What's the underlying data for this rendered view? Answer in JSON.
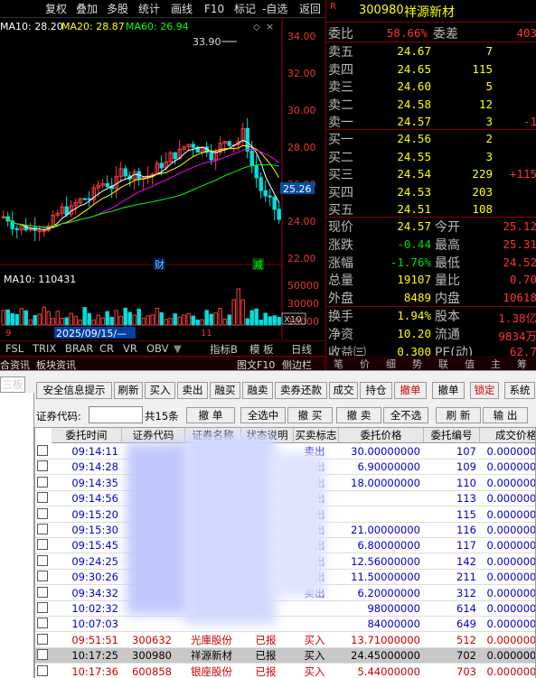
{
  "toolbar": {
    "tabs": [
      "复权",
      "叠加",
      "多股",
      "统计",
      "画线",
      "F10",
      "标记",
      "-自选",
      "返回"
    ]
  },
  "indicators": {
    "ma10": "MA10: 28.20",
    "ma20": "MA20: 28.87",
    "ma60": "MA60: 26.94",
    "high_mark": "33.90",
    "price_tag": "25.26",
    "date_tag": "2025/09/15/—",
    "cai": "财",
    "jian": "减",
    "vol_ma10": "MA10: 110431",
    "vol_x10": "X10",
    "day9": "9",
    "day11": "11",
    "vol_50000": "50000",
    "vol_30000": "30000",
    "vol_10000": "10000"
  },
  "price_axis": [
    "34.00",
    "32.00",
    "30.00",
    "28.00",
    "26.00",
    "24.00",
    "22.00"
  ],
  "bottom_tabs": {
    "tabs": [
      "FSL",
      "TRIX",
      "BRAR",
      "CR",
      "VR",
      "OBV"
    ],
    "indicator_btn": "指标B",
    "template_btn": "模 板",
    "daily": "日线"
  },
  "panel_links": {
    "left": [
      "合资讯",
      "板块资讯"
    ],
    "right": [
      "图文F10",
      "侧边栏"
    ],
    "icons": [
      "笔",
      "价",
      "细",
      "势",
      "联",
      "值",
      "主",
      "筹"
    ]
  },
  "quote": {
    "r_mark": "R",
    "code": "300980",
    "name": "祥源新材",
    "ratio_lbl": "委比",
    "ratio": "58.66%",
    "diff_lbl": "委差",
    "diff": "403",
    "asks": [
      {
        "label": "卖五",
        "price": "24.67",
        "vol": "7",
        "chg": ""
      },
      {
        "label": "卖四",
        "price": "24.65",
        "vol": "115",
        "chg": ""
      },
      {
        "label": "卖三",
        "price": "24.60",
        "vol": "5",
        "chg": ""
      },
      {
        "label": "卖二",
        "price": "24.58",
        "vol": "12",
        "chg": ""
      },
      {
        "label": "卖一",
        "price": "24.57",
        "vol": "3",
        "chg": "-1"
      }
    ],
    "bids": [
      {
        "label": "买一",
        "price": "24.56",
        "vol": "2",
        "chg": ""
      },
      {
        "label": "买二",
        "price": "24.55",
        "vol": "3",
        "chg": ""
      },
      {
        "label": "买三",
        "price": "24.54",
        "vol": "229",
        "chg": "+115"
      },
      {
        "label": "买四",
        "price": "24.53",
        "vol": "203",
        "chg": ""
      },
      {
        "label": "买五",
        "price": "24.51",
        "vol": "108",
        "chg": ""
      }
    ],
    "stats": [
      {
        "l1": "现价",
        "v1": "24.57",
        "l2": "今开",
        "v2": "25.12"
      },
      {
        "l1": "涨跌",
        "v1": "-0.44",
        "l2": "最高",
        "v2": "25.31"
      },
      {
        "l1": "涨幅",
        "v1": "-1.76%",
        "l2": "最低",
        "v2": "24.52"
      },
      {
        "l1": "总量",
        "v1": "19107",
        "l2": "量比",
        "v2": "0.70"
      },
      {
        "l1": "外盘",
        "v1": "8489",
        "l2": "内盘",
        "v2": "10618"
      }
    ],
    "stats2": [
      {
        "l1": "换手",
        "v1": "1.94%",
        "l2": "股本",
        "v2": "1.38亿"
      },
      {
        "l1": "净资",
        "v1": "10.20",
        "l2": "流通",
        "v2": "9834万"
      },
      {
        "l1": "收益㈢",
        "v1": "0.300",
        "l2": "PE(动)",
        "v2": "62.7"
      }
    ]
  },
  "trade": {
    "left_tab": "三板",
    "buttons": [
      "安全信息提示",
      "刷新",
      "买入",
      "卖出",
      "融买",
      "融卖",
      "卖券还款",
      "成交",
      "持仓",
      "撤单",
      "撤单",
      "锁定",
      "系统"
    ],
    "code_label": "证券代码:",
    "code_value": "",
    "count_label": "共15条",
    "row2_buttons": [
      "撤 单",
      "全选中",
      "撤 买",
      "撤 卖",
      "全不选",
      "刷 新",
      "输 出"
    ],
    "columns": [
      "委托时间",
      "证券代码",
      "证券名称",
      "状态说明",
      "买卖标志",
      "委托价格",
      "委托编号",
      "成交价格"
    ],
    "rows": [
      {
        "time": "09:14:11",
        "code": "",
        "name": "",
        "status": "",
        "side": "卖出",
        "price": "30.00000000",
        "id": "107",
        "deal": "0.00000000"
      },
      {
        "time": "09:14:28",
        "code": "",
        "name": "",
        "status": "",
        "side": "卖出",
        "price": "6.90000000",
        "id": "109",
        "deal": "0.00000000"
      },
      {
        "time": "09:14:35",
        "code": "",
        "name": "",
        "status": "",
        "side": "卖出",
        "price": "18.00000000",
        "id": "110",
        "deal": "0.00000000"
      },
      {
        "time": "09:14:56",
        "code": "",
        "name": "",
        "status": "",
        "side": "卖出",
        "price": "",
        "id": "113",
        "deal": "0.00000000"
      },
      {
        "time": "09:15:20",
        "code": "",
        "name": "",
        "status": "",
        "side": "卖出",
        "price": "",
        "id": "115",
        "deal": "0.00000000"
      },
      {
        "time": "09:15:30",
        "code": "",
        "name": "",
        "status": "",
        "side": "卖出",
        "price": "21.00000000",
        "id": "116",
        "deal": "0.00000000"
      },
      {
        "time": "09:15:45",
        "code": "",
        "name": "",
        "status": "",
        "side": "卖出",
        "price": "6.80000000",
        "id": "117",
        "deal": "0.00000000"
      },
      {
        "time": "09:24:25",
        "code": "",
        "name": "",
        "status": "",
        "side": "卖出",
        "price": "12.56000000",
        "id": "142",
        "deal": "0.00000000"
      },
      {
        "time": "09:30:26",
        "code": "",
        "name": "",
        "status": "",
        "side": "卖出",
        "price": "11.50000000",
        "id": "211",
        "deal": "0.00000000"
      },
      {
        "time": "09:34:32",
        "code": "",
        "name": "",
        "status": "",
        "side": "卖出",
        "price": "6.20000000",
        "id": "312",
        "deal": "0.00000000"
      },
      {
        "time": "10:02:32",
        "code": "",
        "name": "",
        "status": "",
        "side": "",
        "price": "98000000",
        "id": "614",
        "deal": "0.00000000"
      },
      {
        "time": "10:07:03",
        "code": "",
        "name": "",
        "status": "",
        "side": "",
        "price": "84000000",
        "id": "649",
        "deal": "0.00000000"
      },
      {
        "time": "09:51:51",
        "code": "300632",
        "name": "光庫股份",
        "status": "已报",
        "side": "买入",
        "price": "13.71000000",
        "id": "512",
        "deal": "0.00000000"
      },
      {
        "time": "10:17:25",
        "code": "300980",
        "name": "祥源新材",
        "status": "已报",
        "side": "买入",
        "price": "24.45000000",
        "id": "702",
        "deal": "0.00000000"
      },
      {
        "time": "10:17:36",
        "code": "600858",
        "name": "银座股份",
        "status": "已报",
        "side": "买入",
        "price": "5.44000000",
        "id": "703",
        "deal": "0.00000000"
      }
    ]
  },
  "colors": {
    "up": "#ff3b3b",
    "down": "#00e0e0",
    "ma10": "#ffffff",
    "ma20": "#ffff00",
    "ma60": "#00ff00",
    "ma_pink": "#ff00ff"
  }
}
